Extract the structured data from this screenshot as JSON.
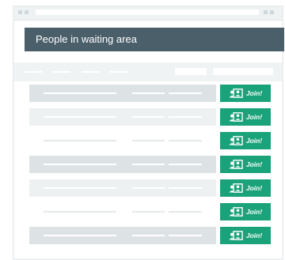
{
  "window": {
    "title": "People in waiting area"
  },
  "rows": [
    {
      "style": "dark",
      "join_label": "Join!"
    },
    {
      "style": "light",
      "join_label": "Join!"
    },
    {
      "style": "white",
      "join_label": "Join!"
    },
    {
      "style": "dark",
      "join_label": "Join!"
    },
    {
      "style": "light",
      "join_label": "Join!"
    },
    {
      "style": "white",
      "join_label": "Join!"
    },
    {
      "style": "dark",
      "join_label": "Join!"
    }
  ],
  "colors": {
    "title_bar": "#4a5f6a",
    "join_button": "#1aa37a"
  },
  "icons": {
    "join": "people-icon"
  }
}
